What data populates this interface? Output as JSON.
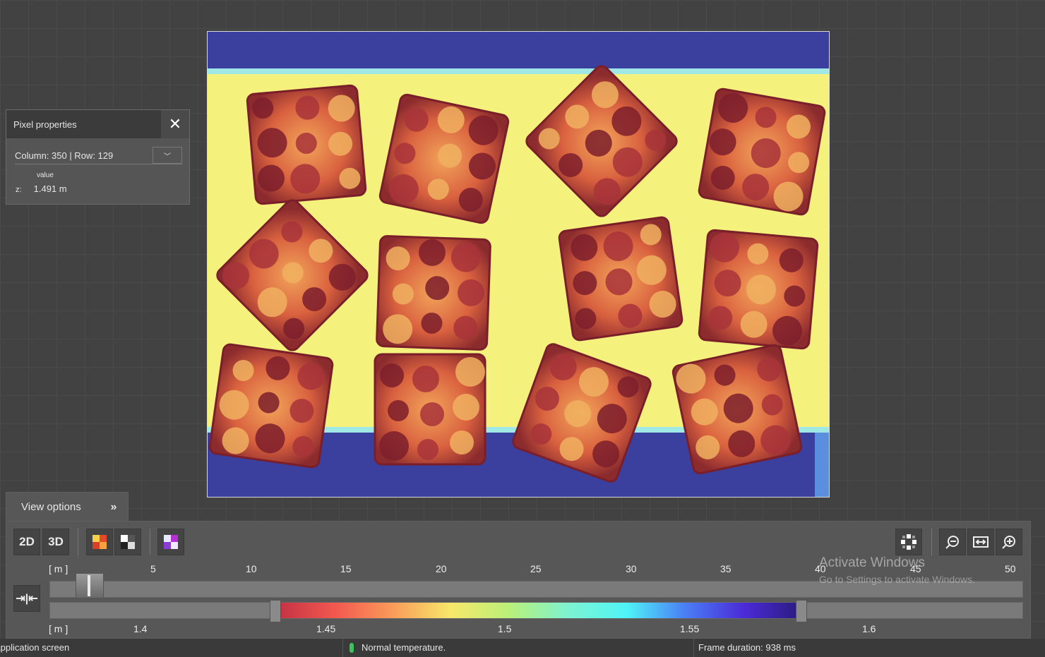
{
  "pixel_panel": {
    "title": "Pixel properties",
    "selector": "Column: 350 | Row: 129",
    "column_header": "value",
    "rows": [
      {
        "axis": "z:",
        "value": "1.491 m"
      }
    ]
  },
  "view_options": {
    "label": "View options",
    "btn_2d": "2D",
    "btn_3d": "3D"
  },
  "range_ruler": {
    "unit": "[ m ]",
    "ticks": [
      "5",
      "10",
      "15",
      "20",
      "25",
      "30",
      "35",
      "40",
      "45",
      "50"
    ]
  },
  "color_ruler": {
    "unit": "[ m ]",
    "ticks": [
      "1.4",
      "1.45",
      "1.5",
      "1.55",
      "1.6"
    ],
    "colormap": [
      "#c23043",
      "#f2574f",
      "#f99b5a",
      "#f7e86a",
      "#b9f07a",
      "#7ef3d0",
      "#4ff4f8",
      "#4a7ef5",
      "#4b2bd9",
      "#2a1b7a"
    ]
  },
  "watermark": {
    "line1": "Activate Windows",
    "line2": "Go to Settings to activate Windows."
  },
  "status": {
    "left": "Application screen",
    "middle": "Normal temperature.",
    "right": "Frame duration: 938 ms"
  },
  "icons": [
    "close-icon",
    "chevron-down-icon",
    "double-chevron-down-icon",
    "color-palette-icon",
    "grayscale-icon",
    "texture-icon",
    "checker-pattern-icon",
    "zoom-out-icon",
    "fit-width-icon",
    "zoom-in-icon",
    "range-compress-icon",
    "thermometer-icon"
  ]
}
